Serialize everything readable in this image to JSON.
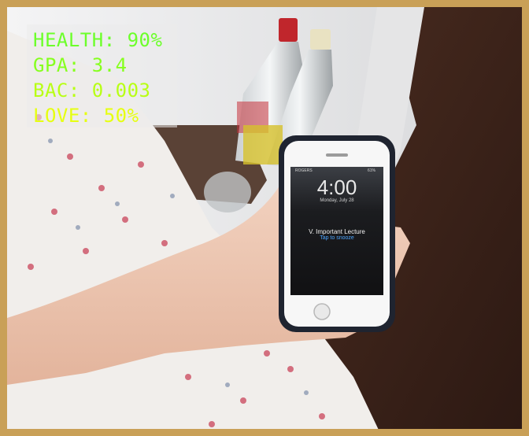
{
  "hud": {
    "lines": [
      {
        "text": "HEALTH: 90%",
        "color": "#6cff2a"
      },
      {
        "text": "GPA: 3.4",
        "color": "#86ff1e"
      },
      {
        "text": "BAC: 0.003",
        "color": "#b8ff14"
      },
      {
        "text": "LOVE: 50%",
        "color": "#e6ff10"
      }
    ]
  },
  "phone": {
    "carrier": "ROGERS",
    "battery": "61%",
    "time": "4:00",
    "date": "Monday, July 28",
    "alarm_title": "V. Important Lecture",
    "alarm_action": "Tap to snooze"
  },
  "colors": {
    "frame": "#c9a057",
    "wall": "#e9e9ea",
    "floor": "#3a2219",
    "blanket": "#f1eeeb"
  }
}
